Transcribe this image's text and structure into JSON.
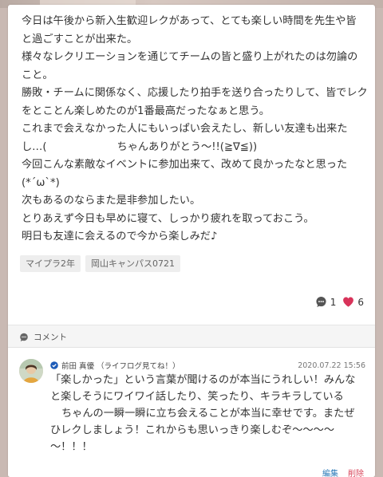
{
  "post": {
    "lines": [
      "今日は午後から新入生歓迎レクがあって、とても楽しい時間を先生や皆",
      "と過ごすことが出来た。",
      "様々なレクリエーションを通じてチームの皆と盛り上がれたのは勿論の",
      "こと。",
      "勝敗・チームに関係なく、応援したり拍手を送り合ったりして、皆でレク",
      "をとことん楽しめたのが1番最高だったなぁと思う。",
      "これまで会えなかった人にもいっぱい会えたし、新しい友達も出来た",
      "し…(",
      "ちゃんありがとう〜!!(≧∇≦))",
      "今回こんな素敵なイベントに参加出来て、改めて良かったなと思った",
      "(*´ω`*)",
      "次もあるのならまた是非参加したい。",
      "とりあえず今日も早めに寝て、しっかり疲れを取っておこう。",
      "明日も友達に会えるので今から楽しみだ♪"
    ]
  },
  "tags": [
    "マイプラ2年",
    "岡山キャンパス0721"
  ],
  "reactions": {
    "comments_count": "1",
    "likes_count": "6",
    "comment_icon": "speech-bubble-icon",
    "like_icon": "heart-icon",
    "like_color": "#d8335a"
  },
  "comments_section": {
    "header_label": "コメント",
    "header_icon": "chat-icon"
  },
  "comment": {
    "author": "前田 真優 （ライフログ見てね！）",
    "timestamp": "2020.07.22 15:56",
    "lines": [
      "「楽しかった」という言葉が聞けるのが本当にうれしい！みんな",
      "と楽しそうにワイワイ話したり、笑ったり、キラキラしている",
      "ちゃんの一瞬一瞬に立ち会えることが本当に幸せです。またぜ",
      "ひレクしましょう！これからも思いっきり楽しむぞ〜〜〜〜",
      "〜！！！"
    ],
    "edit_label": "編集",
    "delete_label": "削除"
  },
  "colors": {
    "link_blue": "#2a7ab8",
    "delete_red": "#d8455a",
    "verified_blue": "#1c5bb8"
  }
}
